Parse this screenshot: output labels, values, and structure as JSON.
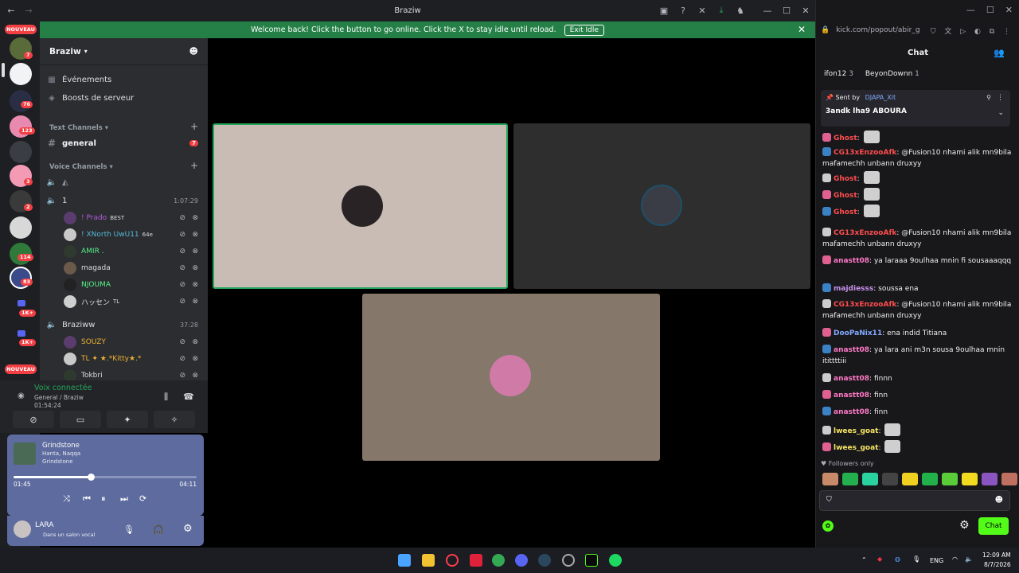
{
  "discord": {
    "window_title": "Braziw",
    "banner": {
      "text": "Welcome back! Click the button to go online. Click the X to stay idle until reload.",
      "button": "Exit Idle"
    },
    "servers": {
      "nouveau_label": "NOUVEAU",
      "badges": [
        "7",
        "76",
        "123",
        "3",
        "2",
        "114",
        "83",
        "1K+",
        "1K+"
      ]
    },
    "guild": {
      "name": "Braziw",
      "events": "Événements",
      "boosts": "Boosts de serveur",
      "text_category": "Text Channels",
      "text_channel": "general",
      "text_channel_badge": "7",
      "voice_category": "Voice Channels",
      "voice_channels": [
        {
          "name": "1",
          "timer": "1:07:29"
        },
        {
          "name": "Braziww",
          "timer": "37:28"
        }
      ],
      "voice_users_1": [
        {
          "name": "! Prado",
          "tag": "BEST",
          "color": "#b45cd6"
        },
        {
          "name": "! XNorth UwU11",
          "tag": "64e",
          "color": "#57b8d6"
        },
        {
          "name": "AMIR .",
          "tag": "",
          "color": "#57f287"
        },
        {
          "name": "magada",
          "tag": "",
          "color": "#dbdee1"
        },
        {
          "name": "NJOUMA",
          "tag": "",
          "color": "#57f287"
        },
        {
          "name": "ハッセン",
          "tag": "TL",
          "color": "#dbdee1"
        }
      ],
      "voice_users_2": [
        {
          "name": "SOUZY",
          "tag": "",
          "color": "#f0b232"
        },
        {
          "name": "TL ✦ ★.*Kitty★.*",
          "tag": "",
          "color": "#f0b232"
        },
        {
          "name": "Tokbri",
          "tag": "",
          "color": "#dbdee1"
        }
      ]
    },
    "voice_connected": {
      "status": "Voix connectée",
      "channel": "General / Braziw",
      "elapsed": "01:54:24"
    },
    "music": {
      "title": "Grindstone",
      "artists": "Hanta, Naqqa",
      "album": "Grindstone",
      "position": "01:45",
      "duration": "04:11",
      "progress": 0.42
    },
    "user": {
      "name": "LARA",
      "status": "Dans un salon vocal"
    },
    "colors": {
      "accent_green": "#248046",
      "server_bg": "#1e1f22",
      "channel_bg": "#2b2d31",
      "music_bg": "#5d6b9e"
    }
  },
  "kick": {
    "url": "kick.com/popout/abir_g",
    "chat_title": "Chat",
    "top_users": [
      {
        "name": "ifon12",
        "count": "3"
      },
      {
        "name": "BeyonDownn",
        "count": "1"
      }
    ],
    "pinned": {
      "sent_by_label": "Sent by",
      "author": "DJAPA_Xit",
      "text": "3andk lha9 ABOURA"
    },
    "messages": [
      {
        "user": "Ghost",
        "text": "",
        "color": "#ff4d4d",
        "emote": true
      },
      {
        "user": "CG13xEnzooAfk",
        "text": "@Fusion10 nhami alik mn9bila mafamechh unbann druxyy",
        "color": "#ff4d4d",
        "emote": false
      },
      {
        "user": "Ghost",
        "text": "",
        "color": "#ff4d4d",
        "emote": true
      },
      {
        "user": "Ghost",
        "text": "",
        "color": "#ff4d4d",
        "emote": true
      },
      {
        "user": "Ghost",
        "text": "",
        "color": "#ff4d4d",
        "emote": true
      },
      {
        "user": "CG13xEnzooAfk",
        "text": "@Fusion10 nhami alik mn9bila mafamechh unbann druxyy",
        "color": "#ff4d4d",
        "emote": false
      },
      {
        "user": "anastt08",
        "text": "ya laraaa 9oulhaa mnin fi sousaaaqqq",
        "color": "#ff79c6",
        "emote": false
      },
      {
        "user": "majdiesss",
        "text": "soussa ena",
        "color": "#c792ea",
        "emote": false
      },
      {
        "user": "CG13xEnzooAfk",
        "text": "@Fusion10 nhami alik mn9bila mafamechh unbann druxyy",
        "color": "#ff4d4d",
        "emote": false
      },
      {
        "user": "DooPaNix11",
        "text": "ena indid Titiana",
        "color": "#82aaff",
        "emote": false
      },
      {
        "user": "anastt08",
        "text": "ya lara ani m3n sousa 9oulhaa mnin itittttiii",
        "color": "#ff79c6",
        "emote": false
      },
      {
        "user": "anastt08",
        "text": "finnn",
        "color": "#ff79c6",
        "emote": false
      },
      {
        "user": "anastt08",
        "text": "finn",
        "color": "#ff79c6",
        "emote": false
      },
      {
        "user": "anastt08",
        "text": "finn",
        "color": "#ff79c6",
        "emote": false
      },
      {
        "user": "lwees_goat",
        "text": "",
        "color": "#f7e463",
        "emote": true
      },
      {
        "user": "lwees_goat",
        "text": "",
        "color": "#f7e463",
        "emote": true
      }
    ],
    "followers_only": "Followers only",
    "chat_button": "Chat",
    "accent": "#53fc18"
  },
  "taskbar": {
    "lang": "ENG",
    "time": "12:09 AM",
    "date": "8/7/2026"
  }
}
